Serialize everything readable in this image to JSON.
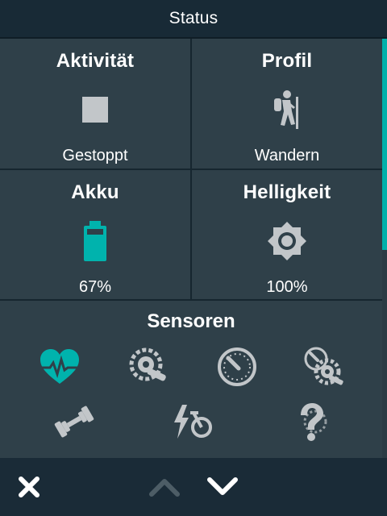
{
  "header": {
    "title": "Status"
  },
  "tiles": [
    {
      "title": "Aktivität",
      "value": "Gestoppt",
      "icon": "stop-icon"
    },
    {
      "title": "Profil",
      "value": "Wandern",
      "icon": "hiker-icon"
    },
    {
      "title": "Akku",
      "value": "67%",
      "icon": "battery-icon",
      "level": 0.67
    },
    {
      "title": "Helligkeit",
      "value": "100%",
      "icon": "brightness-icon",
      "level": 1.0
    }
  ],
  "sensors": {
    "title": "Sensoren",
    "items": [
      {
        "icon": "heart-rate-icon",
        "connected": true
      },
      {
        "icon": "power-meter-icon",
        "connected": false
      },
      {
        "icon": "speed-sensor-icon",
        "connected": false
      },
      {
        "icon": "speed-cadence-sensor-icon",
        "connected": false
      },
      {
        "icon": "smart-trainer-icon",
        "connected": false
      },
      {
        "icon": "ebike-icon",
        "connected": false
      },
      {
        "icon": "unknown-sensor-icon",
        "connected": false
      }
    ]
  },
  "footer": {
    "close": "close-icon",
    "up": "chevron-up-icon",
    "down": "chevron-down-icon"
  },
  "colors": {
    "accent": "#00b3ad",
    "tile": "#2f4049",
    "icon_gray": "#c2c6c9",
    "disabled": "#4d5d66"
  }
}
